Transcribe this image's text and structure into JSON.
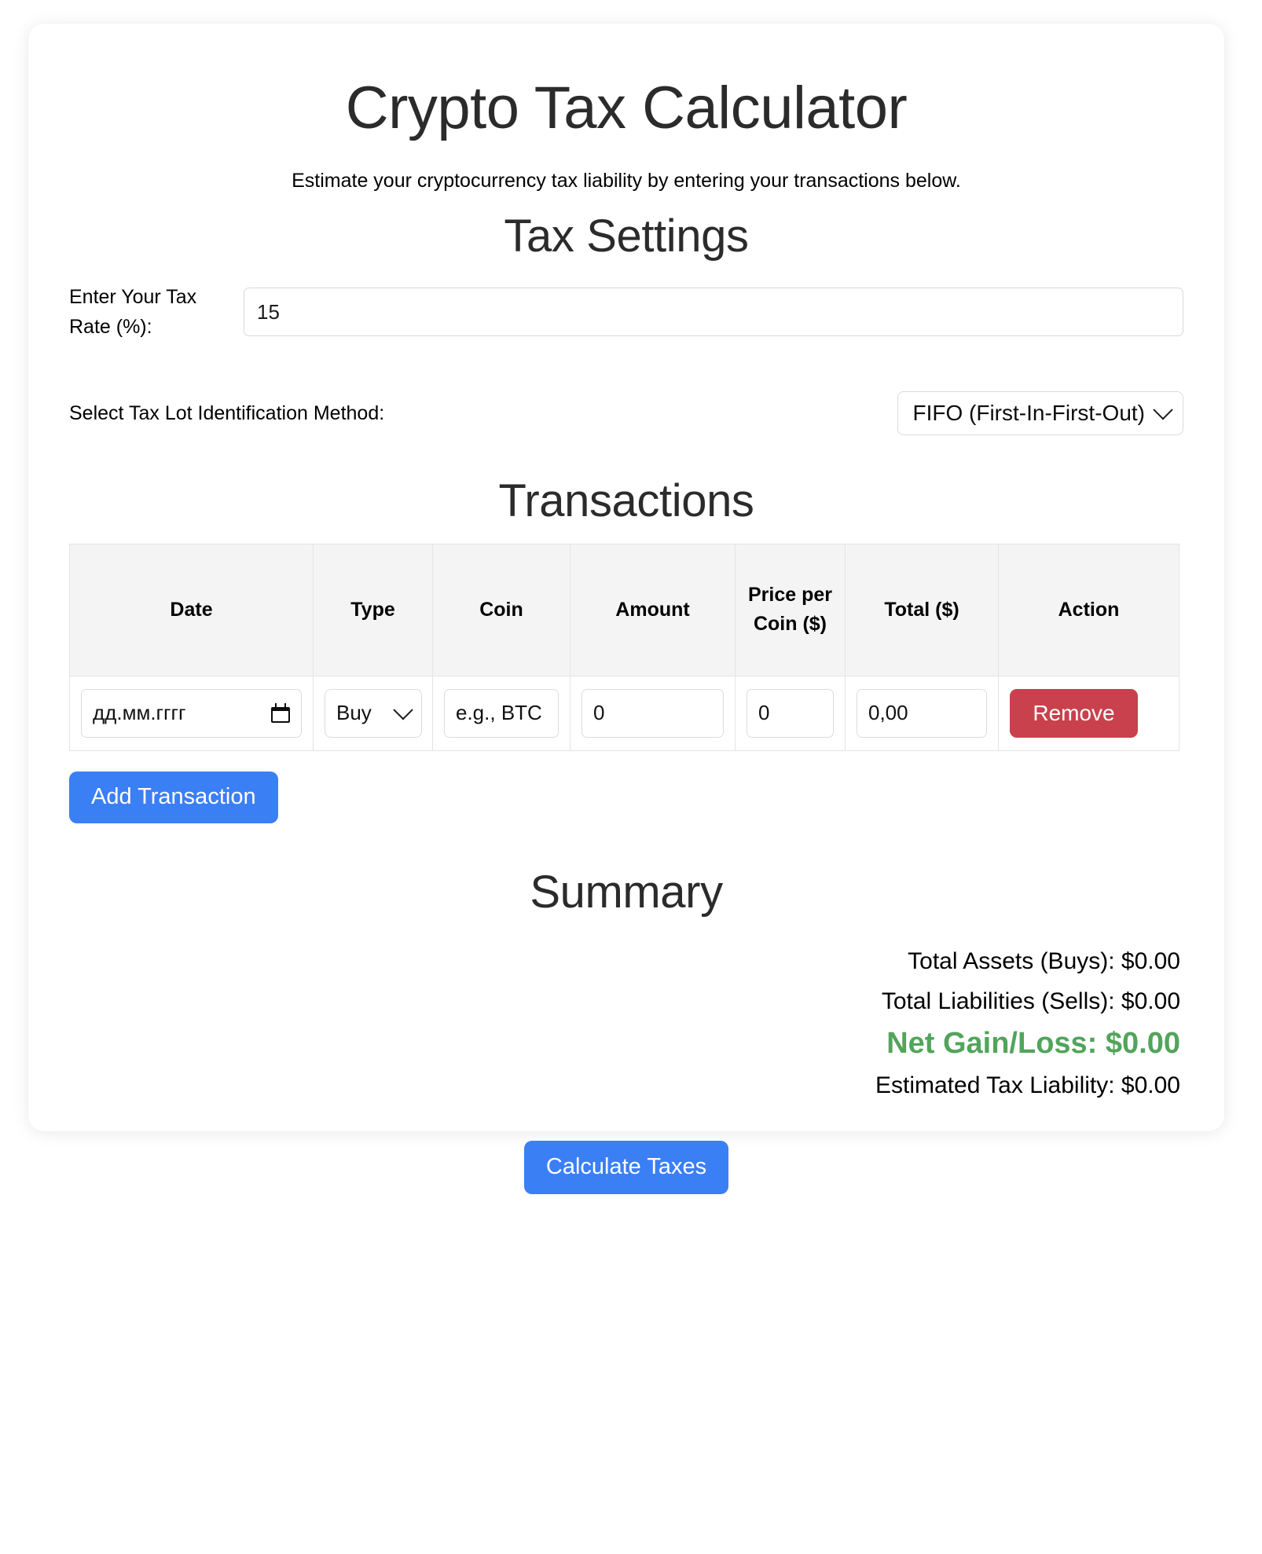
{
  "app": {
    "title": "Crypto Tax Calculator",
    "subtitle": "Estimate your cryptocurrency tax liability by entering your transactions below."
  },
  "tax_settings": {
    "heading": "Tax Settings",
    "rate_label": "Enter Your Tax Rate (%):",
    "rate_value": "15",
    "method_label": "Select Tax Lot Identification Method:",
    "method_value": "FIFO (First-In-First-Out)",
    "method_icon": "chevron-down-icon"
  },
  "transactions": {
    "heading": "Transactions",
    "columns": [
      "Date",
      "Type",
      "Coin",
      "Amount",
      "Price per Coin ($)",
      "Total ($)",
      "Action"
    ],
    "rows": [
      {
        "date_placeholder": "дд.мм.гггг",
        "date_icon": "calendar-icon",
        "type_value": "Buy",
        "type_icon": "chevron-down-icon",
        "coin_placeholder": "e.g., BTC",
        "amount_value": "0",
        "price_value": "0",
        "total_value": "0,00",
        "remove_label": "Remove"
      }
    ],
    "add_label": "Add Transaction"
  },
  "summary": {
    "heading": "Summary",
    "total_assets": "Total Assets (Buys): $0.00",
    "total_liabilities": "Total Liabilities (Sells): $0.00",
    "net_gain_loss": "Net Gain/Loss: $0.00",
    "estimated_tax": "Estimated Tax Liability: $0.00",
    "calculate_label": "Calculate Taxes"
  },
  "colors": {
    "primary_button": "#3b7ff5",
    "danger_button": "#c9414d",
    "positive_text": "#52a45b"
  }
}
